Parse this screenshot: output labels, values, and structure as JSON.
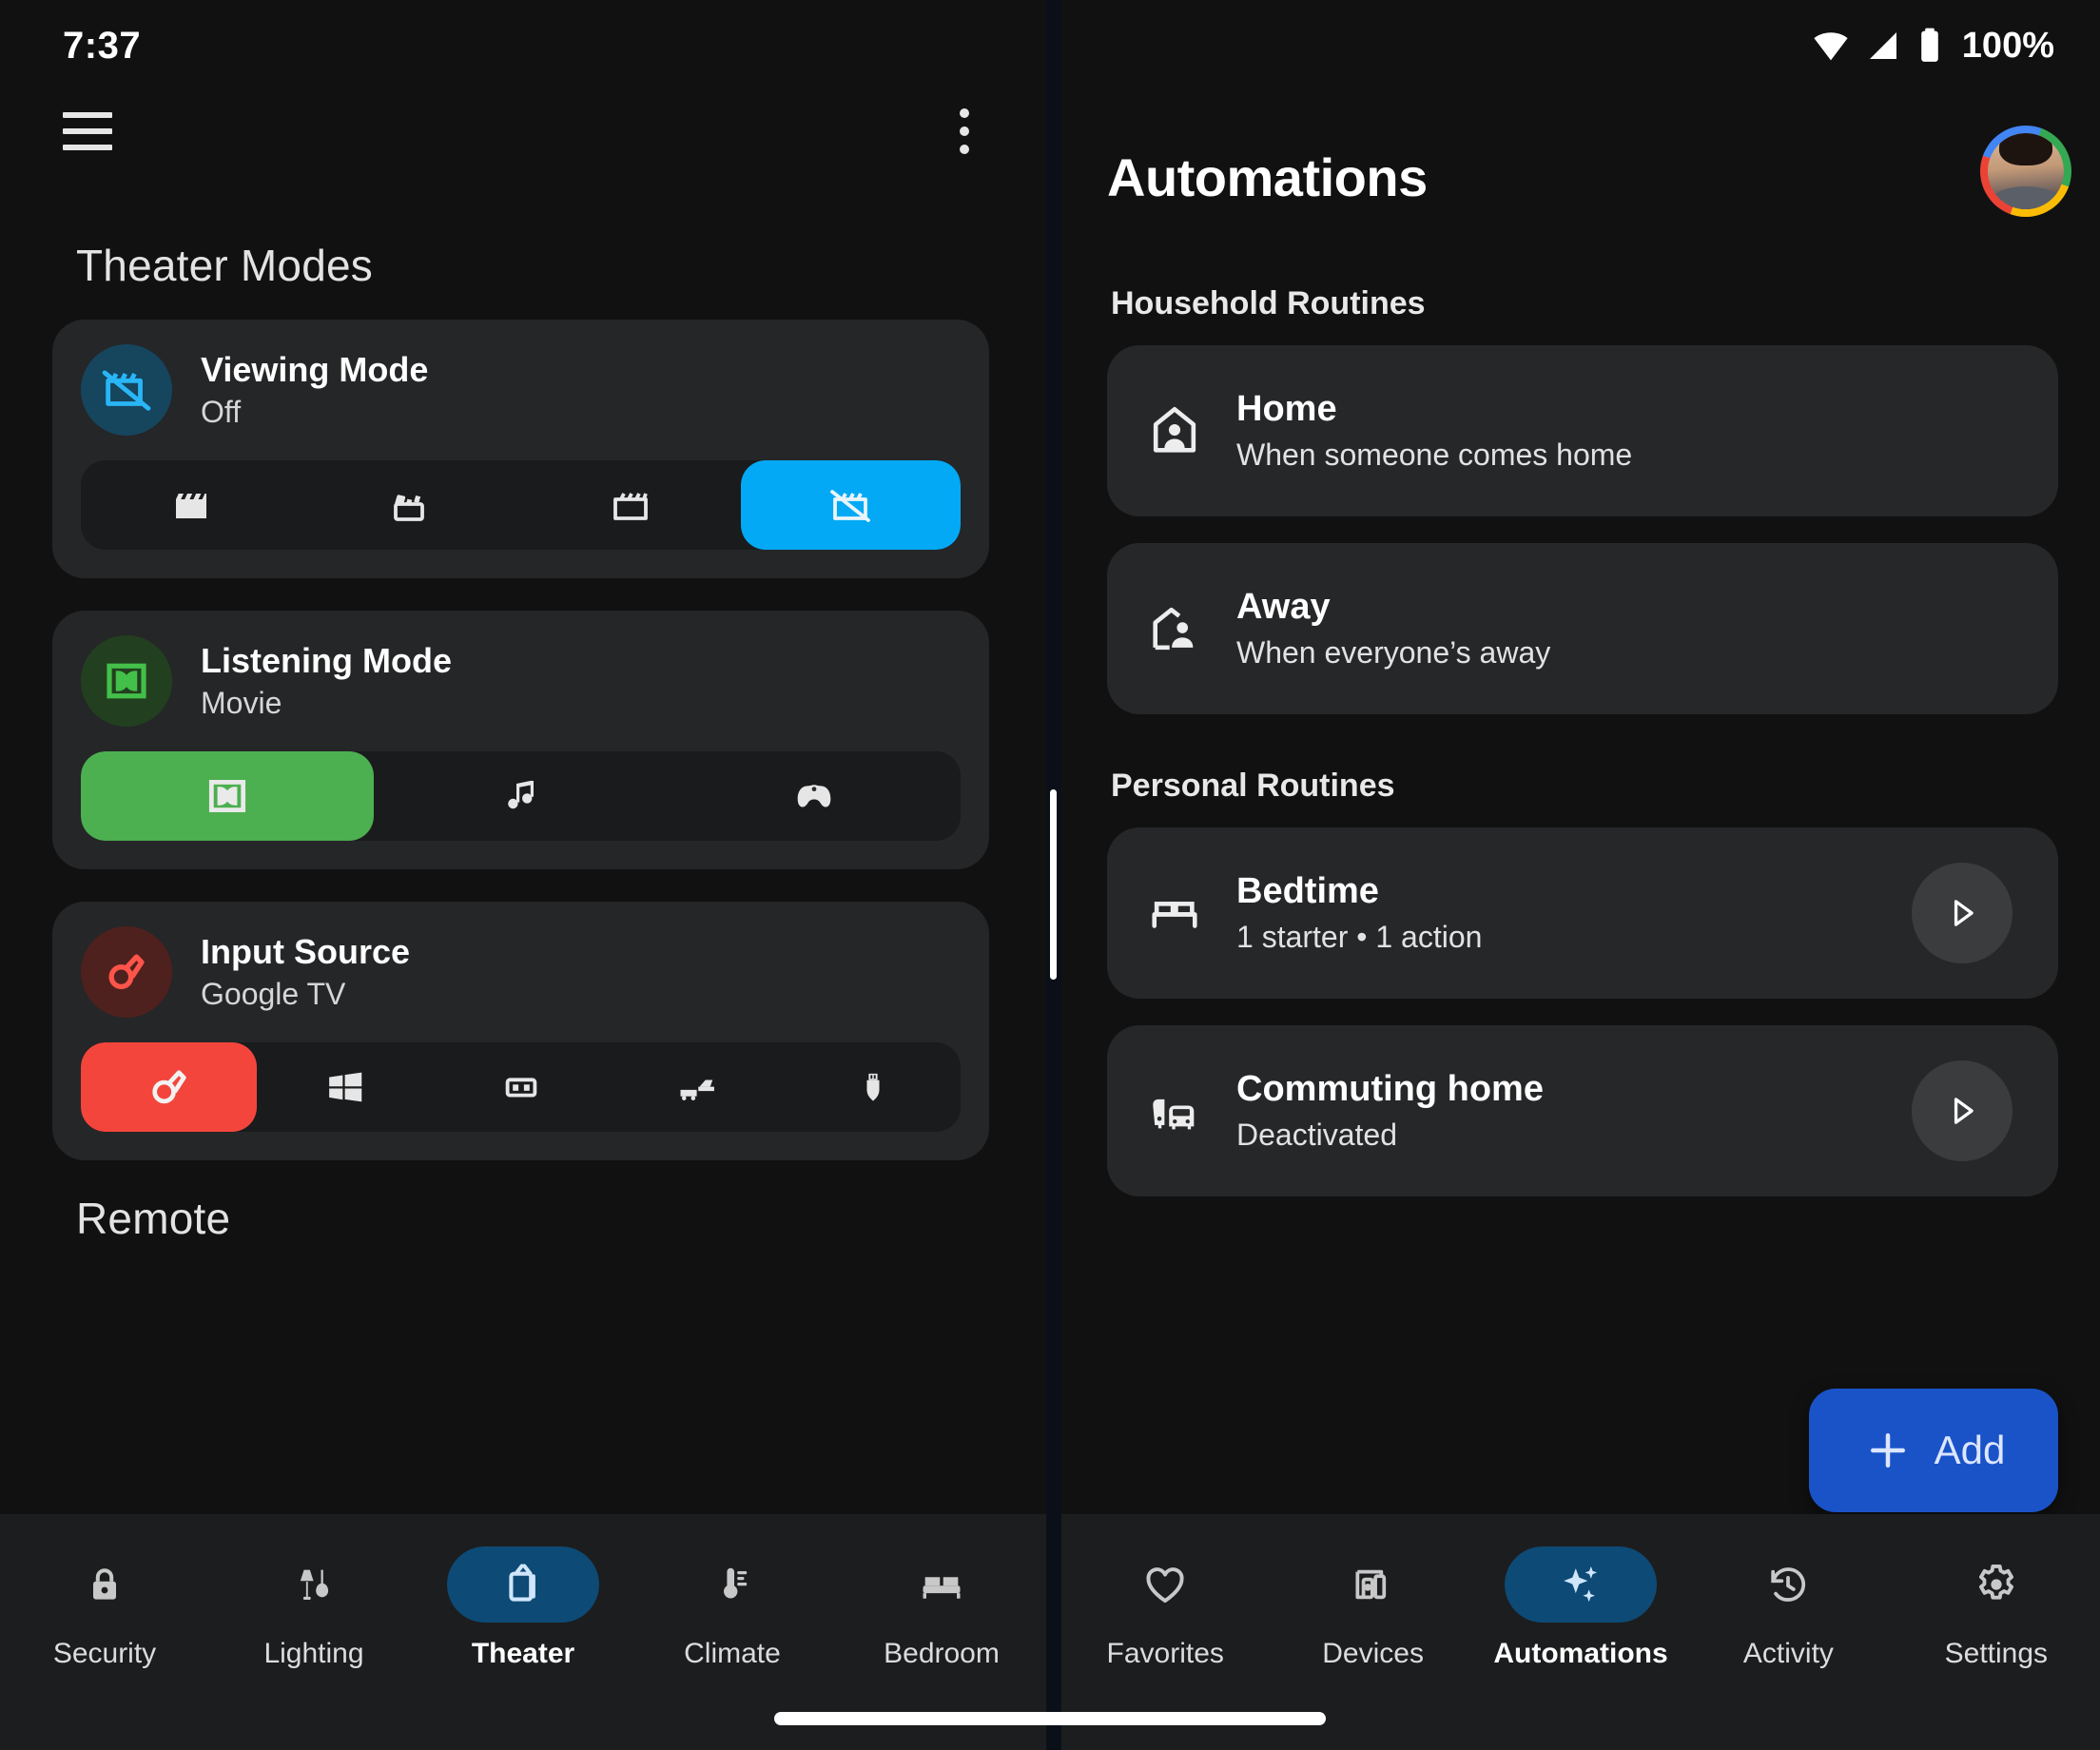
{
  "status_bar": {
    "clock": "7:37",
    "battery_text": "100%",
    "wifi_icon": "wifi-icon",
    "signal_icon": "cell-signal-icon",
    "battery_icon": "battery-full-icon"
  },
  "left_pane": {
    "appbar": {
      "menu_icon": "hamburger-menu-icon",
      "overflow_icon": "more-vert-icon"
    },
    "section_title": "Theater Modes",
    "secondary_section_title": "Remote",
    "cards": [
      {
        "title": "Viewing Mode",
        "subtitle": "Off",
        "accent": "#03A9F4",
        "circle_bg": "#16455e",
        "icon": "movie-off-icon",
        "segments": [
          {
            "icon": "clapper-filled-icon",
            "selected": false
          },
          {
            "icon": "clapper-open-icon",
            "selected": false
          },
          {
            "icon": "clapper-outline-icon",
            "selected": false
          },
          {
            "icon": "movie-off-icon",
            "selected": true
          }
        ]
      },
      {
        "title": "Listening Mode",
        "subtitle": "Movie",
        "accent": "#4CAF50",
        "circle_bg": "#22401f",
        "icon": "dolby-icon",
        "segments": [
          {
            "icon": "dolby-icon",
            "selected": true
          },
          {
            "icon": "music-note-icon",
            "selected": false
          },
          {
            "icon": "gamepad-icon",
            "selected": false
          }
        ]
      },
      {
        "title": "Input Source",
        "subtitle": "Google TV",
        "accent": "#F4453C",
        "circle_bg": "#4e211e",
        "icon": "google-tv-icon",
        "segments": [
          {
            "icon": "google-tv-icon",
            "selected": true
          },
          {
            "icon": "windows-icon",
            "selected": false
          },
          {
            "icon": "media-player-icon",
            "selected": false
          },
          {
            "icon": "soundbar-icon",
            "selected": false
          },
          {
            "icon": "hdmi-plug-icon",
            "selected": false
          }
        ]
      }
    ],
    "bottom_nav": [
      {
        "label": "Security",
        "icon": "lock-icon",
        "active": false
      },
      {
        "label": "Lighting",
        "icon": "lamp-icon",
        "active": false
      },
      {
        "label": "Theater",
        "icon": "tv-icon",
        "active": true
      },
      {
        "label": "Climate",
        "icon": "thermostat-icon",
        "active": false
      },
      {
        "label": "Bedroom",
        "icon": "bed-icon",
        "active": false
      }
    ]
  },
  "right_pane": {
    "title": "Automations",
    "avatar_name": "user-avatar",
    "groups": [
      {
        "label": "Household Routines",
        "routines": [
          {
            "title": "Home",
            "subtitle": "When someone comes home",
            "icon": "home-person-icon",
            "has_play": false
          },
          {
            "title": "Away",
            "subtitle": "When everyone’s away",
            "icon": "house-away-icon",
            "has_play": false
          }
        ]
      },
      {
        "label": "Personal Routines",
        "routines": [
          {
            "title": "Bedtime",
            "subtitle": "1 starter • 1 action",
            "icon": "bed-icon",
            "has_play": true
          },
          {
            "title": "Commuting home",
            "subtitle": "Deactivated",
            "icon": "commute-icon",
            "has_play": true
          }
        ]
      }
    ],
    "fab": {
      "label": "Add",
      "icon": "plus-icon",
      "color": "#1A53C8"
    },
    "bottom_nav": [
      {
        "label": "Favorites",
        "icon": "heart-icon",
        "active": false
      },
      {
        "label": "Devices",
        "icon": "devices-icon",
        "active": false
      },
      {
        "label": "Automations",
        "icon": "sparkles-icon",
        "active": true
      },
      {
        "label": "Activity",
        "icon": "history-icon",
        "active": false
      },
      {
        "label": "Settings",
        "icon": "gear-icon",
        "active": false
      }
    ]
  }
}
